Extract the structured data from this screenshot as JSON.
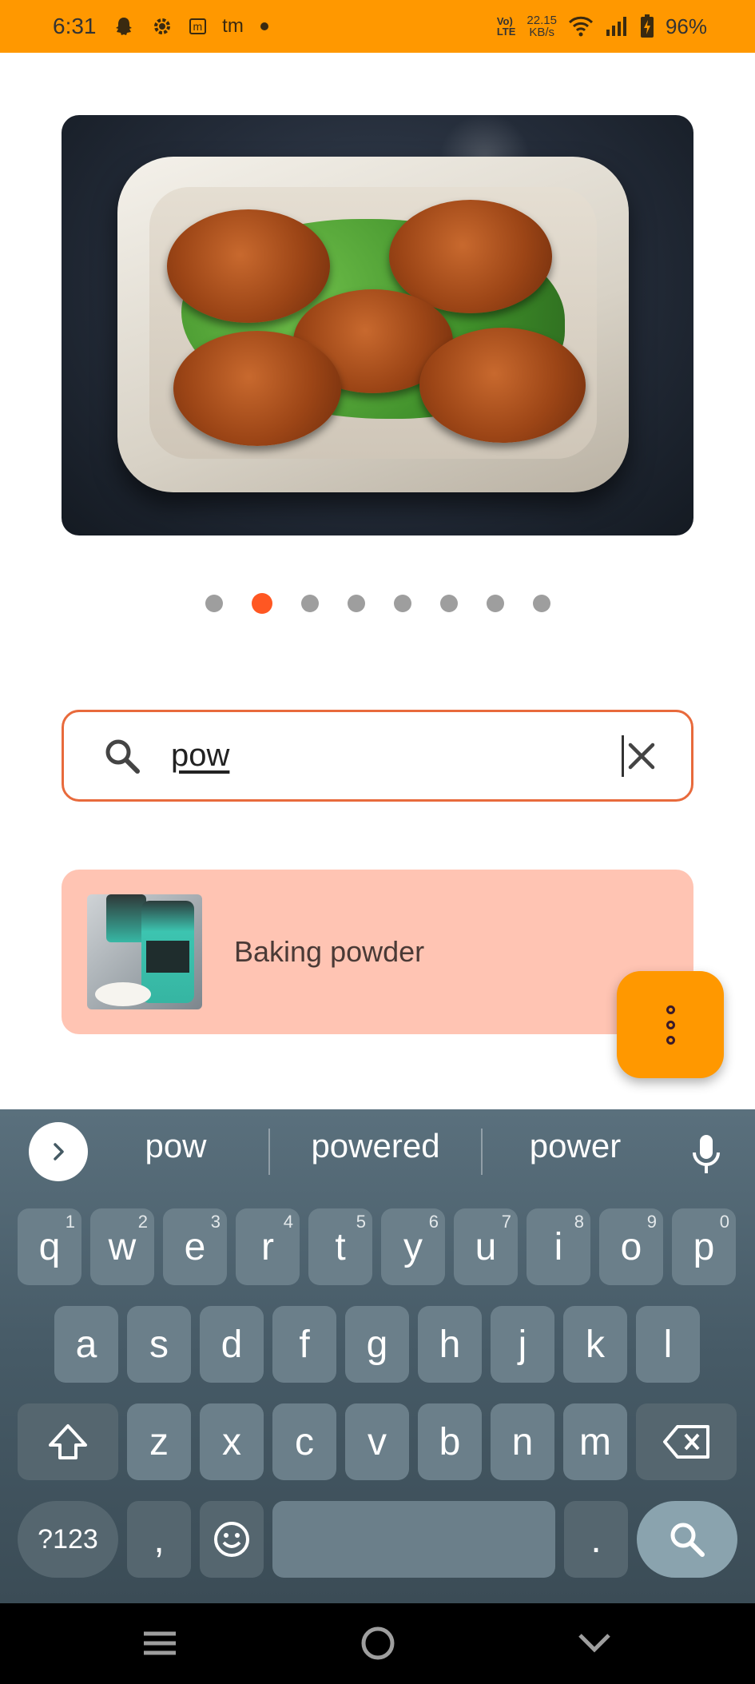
{
  "status_bar": {
    "time": "6:31",
    "icons_left": [
      "snapchat-icon",
      "settings-gear-icon",
      "m-app-icon",
      "tm-app-icon",
      "dot-icon"
    ],
    "m_label": "m",
    "tm_label": "tm",
    "volte_top": "Vo)",
    "volte_bottom": "LTE",
    "net_speed_value": "22.15",
    "net_speed_unit": "KB/s",
    "battery": "96%"
  },
  "hero": {
    "carousel_total": 8,
    "carousel_active_index": 1
  },
  "search": {
    "value": "pow",
    "icon": "search-icon",
    "clear_icon": "close-icon",
    "border_color": "#e86a3c"
  },
  "results": [
    {
      "label": "Baking powder",
      "thumbnail": "baking-powder-thumbnail",
      "background": "#ffc4b3"
    }
  ],
  "fab": {
    "icon": "more-vertical-icon",
    "color": "#ff9800"
  },
  "keyboard": {
    "suggestions": [
      "pow",
      "powered",
      "power"
    ],
    "row1": [
      {
        "k": "q",
        "h": "1"
      },
      {
        "k": "w",
        "h": "2"
      },
      {
        "k": "e",
        "h": "3"
      },
      {
        "k": "r",
        "h": "4"
      },
      {
        "k": "t",
        "h": "5"
      },
      {
        "k": "y",
        "h": "6"
      },
      {
        "k": "u",
        "h": "7"
      },
      {
        "k": "i",
        "h": "8"
      },
      {
        "k": "o",
        "h": "9"
      },
      {
        "k": "p",
        "h": "0"
      }
    ],
    "row2": [
      "a",
      "s",
      "d",
      "f",
      "g",
      "h",
      "j",
      "k",
      "l"
    ],
    "row3": [
      "z",
      "x",
      "c",
      "v",
      "b",
      "n",
      "m"
    ],
    "symbols_label": "?123",
    "comma_label": ",",
    "period_label": "."
  },
  "colors": {
    "accent_orange": "#ff9800",
    "active_dot": "#ff5722",
    "keyboard_bg": "#465a66"
  }
}
